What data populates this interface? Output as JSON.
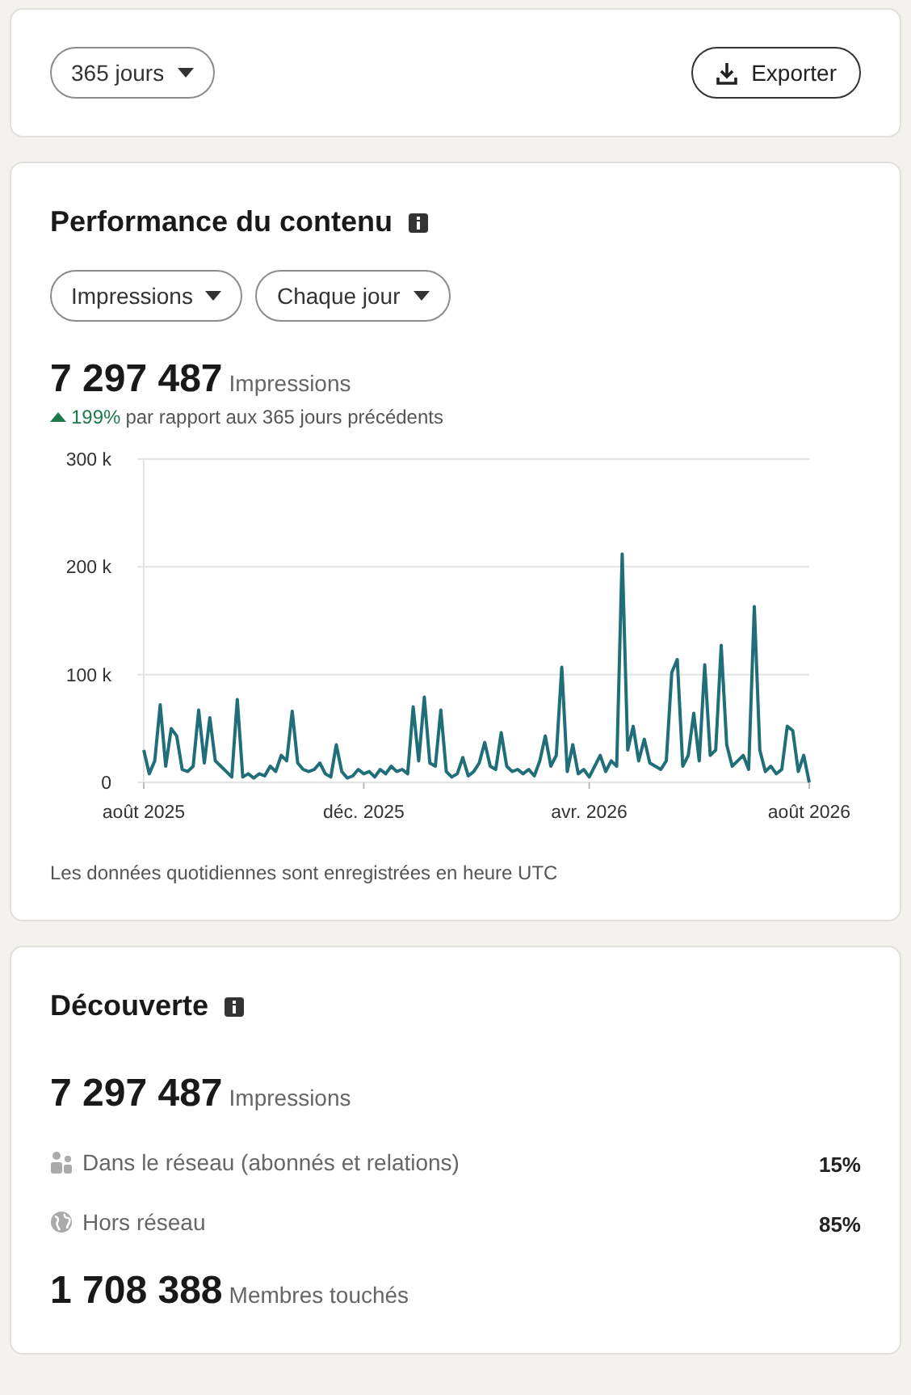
{
  "toolbar": {
    "period": "365 jours",
    "export": "Exporter"
  },
  "performance": {
    "title": "Performance du contenu",
    "filters": [
      "Impressions",
      "Chaque jour"
    ],
    "total": "7 297 487",
    "total_label": "Impressions",
    "change": {
      "rising": true,
      "value": "199%",
      "text": "par rapport aux 365 jours précédents"
    },
    "chart_data": {
      "type": "line",
      "yticks": [
        {
          "value": 0,
          "label": "0"
        },
        {
          "value": 100,
          "label": "100 k"
        },
        {
          "value": 200,
          "label": "200 k"
        },
        {
          "value": 300,
          "label": "300 k"
        }
      ],
      "ylim": [
        0,
        300
      ],
      "categories": [
        "août 2025",
        null,
        null,
        null,
        null,
        null,
        null,
        null,
        null,
        null,
        null,
        null,
        null,
        null,
        null,
        null,
        null,
        null,
        null,
        null,
        null,
        null,
        null,
        null,
        null,
        null,
        null,
        null,
        null,
        null,
        null,
        null,
        null,
        null,
        null,
        null,
        null,
        null,
        null,
        null,
        "déc. 2025",
        null,
        null,
        null,
        null,
        null,
        null,
        null,
        null,
        null,
        null,
        null,
        null,
        null,
        null,
        null,
        null,
        null,
        null,
        null,
        null,
        null,
        null,
        null,
        null,
        null,
        null,
        null,
        null,
        null,
        null,
        null,
        null,
        null,
        null,
        null,
        null,
        null,
        null,
        null,
        null,
        "avr. 2026",
        null,
        null,
        null,
        null,
        null,
        null,
        null,
        null,
        null,
        null,
        null,
        null,
        null,
        null,
        null,
        null,
        null,
        null,
        null,
        null,
        null,
        null,
        null,
        null,
        null,
        null,
        null,
        null,
        null,
        null,
        null,
        null,
        null,
        null,
        null,
        null,
        null,
        null,
        null,
        "août 2026"
      ],
      "series": [
        {
          "color": "#1f6e78",
          "values": [
            30,
            8,
            20,
            72,
            15,
            50,
            43,
            12,
            10,
            15,
            67,
            18,
            60,
            20,
            15,
            10,
            5,
            77,
            5,
            8,
            4,
            8,
            6,
            15,
            10,
            25,
            20,
            66,
            18,
            12,
            10,
            12,
            18,
            8,
            5,
            35,
            10,
            4,
            6,
            12,
            8,
            10,
            5,
            12,
            8,
            15,
            10,
            12,
            8,
            70,
            20,
            79,
            18,
            15,
            67,
            10,
            5,
            8,
            23,
            6,
            10,
            18,
            37,
            15,
            12,
            46,
            15,
            10,
            12,
            8,
            12,
            6,
            20,
            43,
            15,
            25,
            107,
            10,
            35,
            8,
            12,
            5,
            15,
            25,
            10,
            20,
            15,
            212,
            30,
            52,
            20,
            40,
            18,
            15,
            12,
            20,
            102,
            114,
            15,
            25,
            64,
            20,
            109,
            25,
            30,
            127,
            35,
            15,
            20,
            25,
            12,
            163,
            30,
            10,
            15,
            8,
            12,
            52,
            48,
            10,
            25,
            0
          ]
        }
      ]
    },
    "note": "Les données quotidiennes sont enregistrées en heure UTC"
  },
  "discovery": {
    "title": "Découverte",
    "total": "7 297 487",
    "total_label": "Impressions",
    "rows": [
      {
        "kind": "in_network",
        "label": "Dans le réseau (abonnés et relations)",
        "value": "15%"
      },
      {
        "kind": "out_network",
        "label": "Hors réseau",
        "value": "85%"
      }
    ],
    "members": "1 708 388",
    "members_label": "Membres touchés"
  }
}
